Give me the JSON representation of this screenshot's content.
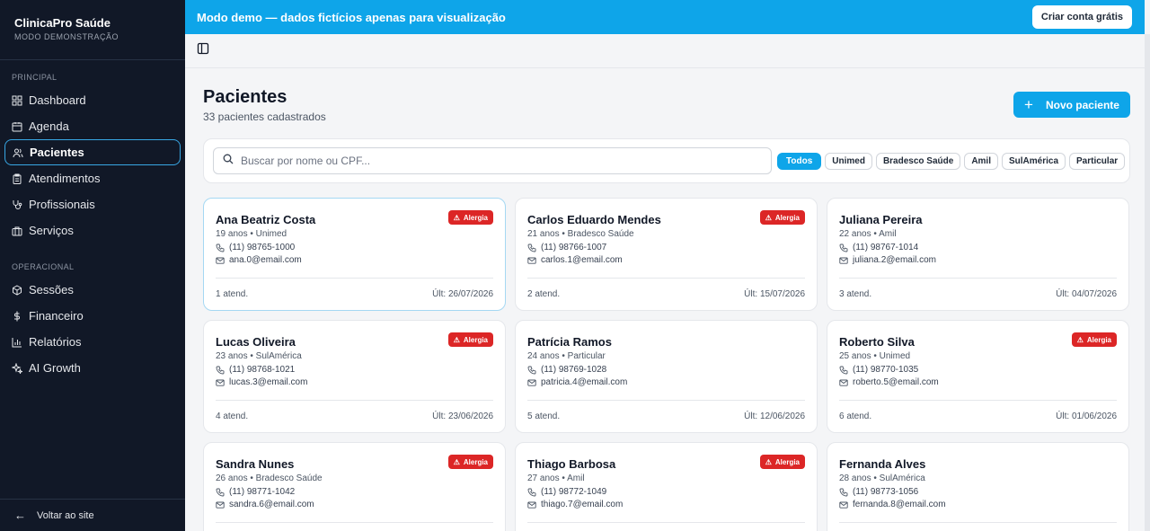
{
  "app": {
    "title": "ClinicaPro Saúde",
    "subtitle": "MODO DEMONSTRAÇÃO"
  },
  "sidebar": {
    "principal_label": "PRINCIPAL",
    "operacional_label": "OPERACIONAL",
    "principal": [
      {
        "label": "Dashboard",
        "icon": "dashboard-icon"
      },
      {
        "label": "Agenda",
        "icon": "calendar-icon"
      },
      {
        "label": "Pacientes",
        "icon": "users-icon",
        "active": true
      },
      {
        "label": "Atendimentos",
        "icon": "clipboard-icon"
      },
      {
        "label": "Profissionais",
        "icon": "stethoscope-icon"
      },
      {
        "label": "Serviços",
        "icon": "briefcase-icon"
      }
    ],
    "operacional": [
      {
        "label": "Sessões",
        "icon": "package-icon"
      },
      {
        "label": "Financeiro",
        "icon": "dollar-icon"
      },
      {
        "label": "Relatórios",
        "icon": "bar-chart-icon"
      },
      {
        "label": "AI Growth",
        "icon": "sparkles-icon"
      }
    ],
    "back_label": "Voltar ao site"
  },
  "banner": {
    "text": "Modo demo — dados fictícios apenas para visualização",
    "button": "Criar conta grátis"
  },
  "page": {
    "title": "Pacientes",
    "subtitle": "33 pacientes cadastrados",
    "new_button": "Novo paciente"
  },
  "search": {
    "placeholder": "Buscar por nome ou CPF...",
    "value": ""
  },
  "filters": [
    "Todos",
    "Unimed",
    "Bradesco Saúde",
    "Amil",
    "SulAmérica",
    "Particular"
  ],
  "active_filter": "Todos",
  "patients": [
    {
      "name": "Ana Beatriz Costa",
      "meta": "19 anos • Unimed",
      "phone": "(11) 98765-1000",
      "email": "ana.0@email.com",
      "visits": "1 atend.",
      "last": "Últ: 26/07/2026",
      "allergy": true
    },
    {
      "name": "Carlos Eduardo Mendes",
      "meta": "21 anos • Bradesco Saúde",
      "phone": "(11) 98766-1007",
      "email": "carlos.1@email.com",
      "visits": "2 atend.",
      "last": "Últ: 15/07/2026",
      "allergy": true
    },
    {
      "name": "Juliana Pereira",
      "meta": "22 anos • Amil",
      "phone": "(11) 98767-1014",
      "email": "juliana.2@email.com",
      "visits": "3 atend.",
      "last": "Últ: 04/07/2026",
      "allergy": false
    },
    {
      "name": "Lucas Oliveira",
      "meta": "23 anos • SulAmérica",
      "phone": "(11) 98768-1021",
      "email": "lucas.3@email.com",
      "visits": "4 atend.",
      "last": "Últ: 23/06/2026",
      "allergy": true
    },
    {
      "name": "Patrícia Ramos",
      "meta": "24 anos • Particular",
      "phone": "(11) 98769-1028",
      "email": "patricia.4@email.com",
      "visits": "5 atend.",
      "last": "Últ: 12/06/2026",
      "allergy": false
    },
    {
      "name": "Roberto Silva",
      "meta": "25 anos • Unimed",
      "phone": "(11) 98770-1035",
      "email": "roberto.5@email.com",
      "visits": "6 atend.",
      "last": "Últ: 01/06/2026",
      "allergy": true
    },
    {
      "name": "Sandra Nunes",
      "meta": "26 anos • Bradesco Saúde",
      "phone": "(11) 98771-1042",
      "email": "sandra.6@email.com",
      "visits": "",
      "last": "",
      "allergy": true
    },
    {
      "name": "Thiago Barbosa",
      "meta": "27 anos • Amil",
      "phone": "(11) 98772-1049",
      "email": "thiago.7@email.com",
      "visits": "",
      "last": "",
      "allergy": true
    },
    {
      "name": "Fernanda Alves",
      "meta": "28 anos • SulAmérica",
      "phone": "(11) 98773-1056",
      "email": "fernanda.8@email.com",
      "visits": "",
      "last": "",
      "allergy": false
    }
  ],
  "allergy_label": "Alergia",
  "colors": {
    "sidebar_bg": "#111827",
    "accent": "#0ea5e9",
    "allergy": "#dc2626"
  }
}
